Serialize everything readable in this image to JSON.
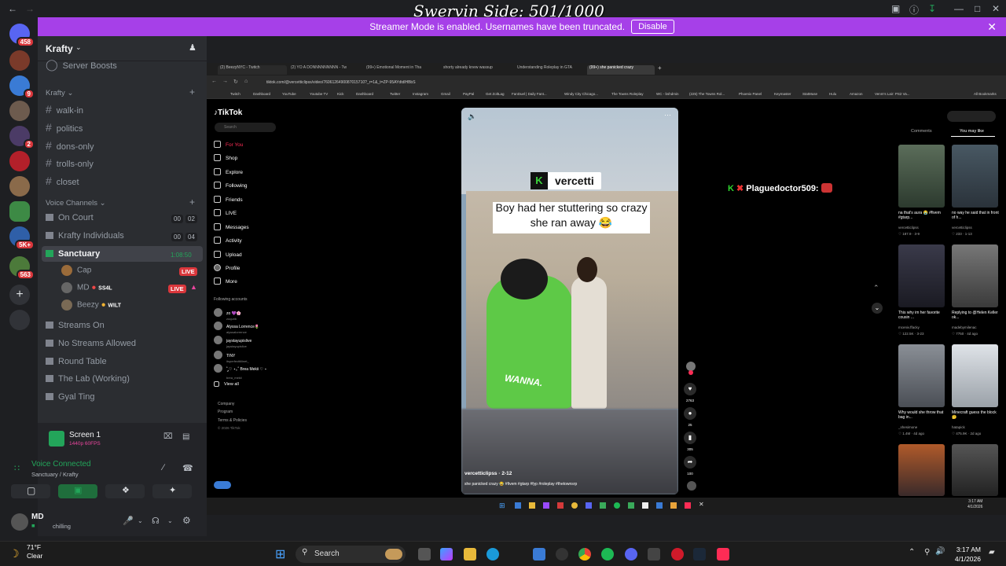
{
  "overlay_title": "Swervin Side: 501/1000",
  "streamer_banner": {
    "text": "Streamer Mode is enabled. Usernames have been truncated.",
    "button": "Disable"
  },
  "server_rail": {
    "badges": [
      "458",
      "9",
      "2",
      "5K+",
      "563"
    ]
  },
  "discord": {
    "server_name": "Krafty",
    "partial_item": "Server Boosts",
    "category_text": "Krafty",
    "text_channels": [
      "walk-in",
      "politics",
      "dons-only",
      "trolls-only",
      "closet"
    ],
    "category_voice": "Voice Channels",
    "voice_channels": [
      {
        "name": "On Court",
        "count_a": "00",
        "count_b": "02"
      },
      {
        "name": "Krafty Individuals",
        "count_a": "00",
        "count_b": "04"
      },
      {
        "name": "Sanctuary",
        "timer": "1:08:50"
      }
    ],
    "voice_users": [
      {
        "name": "Cap",
        "live": "LIVE"
      },
      {
        "name": "MD",
        "tag": "SS4L",
        "live": "LIVE"
      },
      {
        "name": "Beezy",
        "tag": "WILT"
      }
    ],
    "more_channels": [
      "Streams On",
      "No Streams Allowed",
      "Round Table",
      "The Lab (Working)",
      "Gyal Ting"
    ],
    "screen_share": {
      "title": "Screen 1",
      "sub": "1440p 60FPS"
    },
    "voice_status": {
      "title": "Voice Connected",
      "sub": "Sanctuary / Krafty"
    },
    "user": {
      "name": "MD",
      "status": "chilling"
    }
  },
  "browser": {
    "tabs": [
      "(2) BeezyNYC - Twitch",
      "(2) YO A DONNNNNNNNN - Tw",
      "(99+) Emotional Moment in Tha",
      "shorty already knew wassup",
      "Understanding Roleplay in GTA",
      "(99+) she panicked crazy"
    ],
    "url": "tiktok.com/@vercetticlipss/video/7606126490087015710?_r=1&_t=ZP-95AYdtdlHBbS",
    "bookmarks": [
      "Twitch",
      "Dashboard",
      "YouTube",
      "Youtube TV",
      "Kick",
      "Dashboard",
      "Twitter",
      "Instagram",
      "Gmail",
      "PayPal",
      "Get ZoltLag",
      "FanDuel | Daily Fant...",
      "Windy City Chicago...",
      "The Towns Roleplay",
      "WC - bshdmin",
      "(225) The Towns Rol...",
      "Phoenix Panel",
      "Keymaster",
      "StatMuse",
      "Hulu",
      "Amazon",
      "Venm's Lair: PS2 Va...",
      "All Bookmarks"
    ]
  },
  "tiktok": {
    "logo": "TikTok",
    "search_placeholder": "Search",
    "nav": [
      "For You",
      "Shop",
      "Explore",
      "Following",
      "Friends",
      "LIVE",
      "Messages",
      "Activity",
      "Upload",
      "Profile",
      "More"
    ],
    "following_header": "Following accounts",
    "following": [
      {
        "name": "zo 💜🌸",
        "sub": "zoqurib"
      },
      {
        "name": "Alyssa Lorrence🌷",
        "sub": "alyssalorrence"
      },
      {
        "name": "jaystayupislive",
        "sub": "jaystayupislive"
      },
      {
        "name": "TINY",
        "sub": "itsperfecttiiiinet_"
      },
      {
        "name": "˚ ༘♡ ⋆｡˚ Brea Mekii ♡ ⋆",
        "sub": "brea_mekii"
      }
    ],
    "view_all": "View all",
    "footer": [
      "Company",
      "Program",
      "Terms & Policies",
      "© 2026 TikTok"
    ],
    "video": {
      "badge": "vercetti",
      "caption": "Boy had her stuttering so crazy she ran away 😂",
      "overlay_word": "WANNA.",
      "username": "vercetticlipss · 2-12",
      "description": "she panicked crazy 😂 #fivem #gtarp #fyp #roleplay #thetownsrp"
    },
    "action_counts": [
      "2763",
      "25",
      "305",
      "100"
    ],
    "chat_overlay": "Plaguedoctor509:",
    "side_tabs": [
      "Comments",
      "You may like"
    ],
    "suggestions": [
      {
        "caption": "na that's aura 😭 #fivem #gtarp...",
        "author": "vercetticlipss",
        "meta": "♡ 187.9 · 3-9"
      },
      {
        "caption": "no way he said that in front of h...",
        "author": "vercetticlipss",
        "meta": "♡ 233 · 1-13"
      },
      {
        "caption": "This why im her favorite cousin ...",
        "author": "mceniv.ffacky",
        "meta": "♡ 122.5K · 3-23"
      },
      {
        "caption": "Replying to @Helen Keller ok...",
        "author": "madebymilenac",
        "meta": "♡ 7750 · 4d ago"
      },
      {
        "caption": "Why would she throw that bag in...",
        "author": "_shesimone",
        "meta": "♡ 1.4M · 4d ago"
      },
      {
        "caption": "Minecraft guess the block 🤔",
        "author": "hatapick",
        "meta": "♡ 475.9K · 2d ago"
      }
    ]
  },
  "taskbar": {
    "weather_temp": "71°F",
    "weather_desc": "Clear",
    "search_label": "Search",
    "time": "3:17 AM",
    "date": "4/1/2026",
    "inner_time": "3:17 AM",
    "inner_date": "4/1/2026"
  },
  "colors": {
    "banner": "#a640e8",
    "discord_bg": "#2b2d31",
    "live": "#da373c",
    "voice_green": "#23a55a",
    "tiktok_accent": "#fe2c55"
  }
}
